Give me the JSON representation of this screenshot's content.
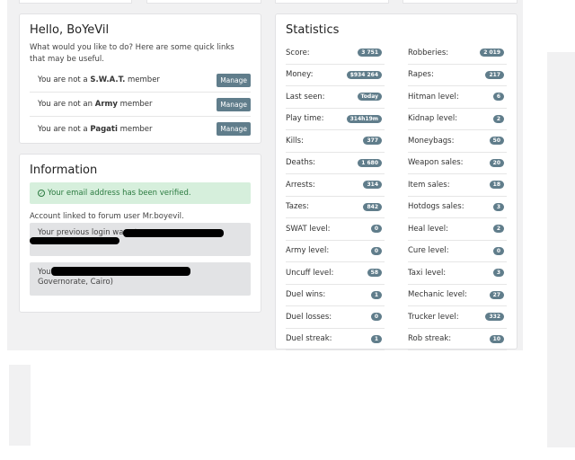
{
  "hello": {
    "title": "Hello, BoYeVil",
    "lead": "What would you like to do? Here are some quick links that may be useful.",
    "rows": [
      {
        "prefix": "You are not a ",
        "group": "S.W.A.T.",
        "suffix": " member",
        "button": "Manage"
      },
      {
        "prefix": "You are not an ",
        "group": "Army",
        "suffix": " member",
        "button": "Manage"
      },
      {
        "prefix": "You are not a ",
        "group": "Pagati",
        "suffix": " member",
        "button": "Manage"
      }
    ]
  },
  "info": {
    "title": "Information",
    "verified": "Your email address has been verified.",
    "linked": "Account linked to forum user Mr.boyevil.",
    "previous_login": "Your previous login was at",
    "you_prefix": "You",
    "you_location": "Governorate, Cairo)"
  },
  "stats": {
    "title": "Statistics",
    "left": [
      {
        "label": "Score:",
        "value": "3 751"
      },
      {
        "label": "Money:",
        "value": "$934 264"
      },
      {
        "label": "Last seen:",
        "value": "Today"
      },
      {
        "label": "Play time:",
        "value": "314h19m"
      },
      {
        "label": "Kills:",
        "value": "377"
      },
      {
        "label": "Deaths:",
        "value": "1 680"
      },
      {
        "label": "Arrests:",
        "value": "314"
      },
      {
        "label": "Tazes:",
        "value": "842"
      },
      {
        "label": "SWAT level:",
        "value": "0"
      },
      {
        "label": "Army level:",
        "value": "0"
      },
      {
        "label": "Uncuff level:",
        "value": "58"
      },
      {
        "label": "Duel wins:",
        "value": "1"
      },
      {
        "label": "Duel losses:",
        "value": "0"
      },
      {
        "label": "Duel streak:",
        "value": "1"
      }
    ],
    "right": [
      {
        "label": "Robberies:",
        "value": "2 019"
      },
      {
        "label": "Rapes:",
        "value": "217"
      },
      {
        "label": "Hitman level:",
        "value": "6"
      },
      {
        "label": "Kidnap level:",
        "value": "2"
      },
      {
        "label": "Moneybags:",
        "value": "50"
      },
      {
        "label": "Weapon sales:",
        "value": "20"
      },
      {
        "label": "Item sales:",
        "value": "18"
      },
      {
        "label": "Hotdogs sales:",
        "value": "3"
      },
      {
        "label": "Heal level:",
        "value": "2"
      },
      {
        "label": "Cure level:",
        "value": "0"
      },
      {
        "label": "Taxi level:",
        "value": "3"
      },
      {
        "label": "Mechanic level:",
        "value": "27"
      },
      {
        "label": "Trucker level:",
        "value": "332"
      },
      {
        "label": "Rob streak:",
        "value": "10"
      }
    ]
  },
  "colors": {
    "badge": "#607d8b",
    "success_bg": "#d6efdc",
    "success_text": "#2a7a3f"
  }
}
